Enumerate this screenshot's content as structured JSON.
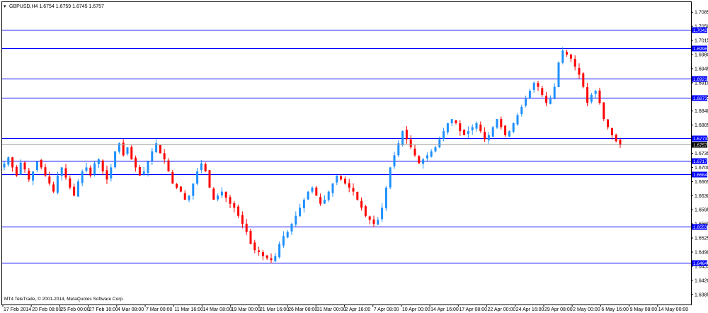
{
  "header": {
    "menu_glyph": "▾",
    "symbol_info": "GBPUSD,H4  1.6754 1.6759 1.6745 1.6757"
  },
  "footer": {
    "copyright": "MT4 TeleTrade, © 2001-2014, MetaQuotes Software Corp."
  },
  "colors": {
    "background": "#ffffff",
    "frame": "#000000",
    "bull_candle": "#1e90ff",
    "bear_candle": "#ff0000",
    "level_line": "#0000ff",
    "level_tag_bg": "#0000ff",
    "price_tag_bg": "#000000",
    "current_price_line": "#a0a0a0"
  },
  "chart_data": {
    "type": "candlestick",
    "symbol": "GBPUSD",
    "timeframe": "H4",
    "ylim": [
      1.636,
      1.711
    ],
    "y_ticks": [
      "1.7085",
      "1.7050",
      "1.7015",
      "1.6980",
      "1.6945",
      "1.6910",
      "1.6875",
      "1.6840",
      "1.6805",
      "1.6770",
      "1.6735",
      "1.6700",
      "1.6665",
      "1.6630",
      "1.6595",
      "1.6560",
      "1.6525",
      "1.6490",
      "1.6455",
      "1.6420",
      "1.6385"
    ],
    "x_ticks": [
      "17 Feb 2014",
      "20 Feb 08:00",
      "25 Feb 00:00",
      "27 Feb 16:00",
      "4 Mar 08:00",
      "7 Mar 00:00",
      "11 Mar 16:00",
      "14 Mar 08:00",
      "19 Mar 00:00",
      "21 Mar 16:00",
      "26 Mar 08:00",
      "31 Mar 00:00",
      "2 Apr 16:00",
      "7 Apr 08:00",
      "10 Apr 00:00",
      "14 Apr 16:00",
      "17 Apr 08:00",
      "22 Apr 00:00",
      "24 Apr 16:00",
      "29 Apr 08:00",
      "2 May 00:00",
      "6 May 16:00",
      "9 May 08:00",
      "14 May 00:00"
    ],
    "horizontal_levels": [
      "1.7042",
      "1.6996",
      "1.6921",
      "1.6873",
      "1.6773",
      "1.6717",
      "1.6684",
      "1.6553",
      "1.6464"
    ],
    "current_price": "1.6757",
    "grid": false,
    "closes": [
      1.671,
      1.6725,
      1.67,
      1.668,
      1.6712,
      1.6695,
      1.667,
      1.669,
      1.6715,
      1.67,
      1.668,
      1.666,
      1.664,
      1.668,
      1.67,
      1.6675,
      1.665,
      1.663,
      1.6665,
      1.669,
      1.67,
      1.668,
      1.671,
      1.672,
      1.669,
      1.667,
      1.67,
      1.674,
      1.676,
      1.673,
      1.675,
      1.672,
      1.67,
      1.668,
      1.669,
      1.6715,
      1.674,
      1.676,
      1.6735,
      1.672,
      1.669,
      1.666,
      1.665,
      1.664,
      1.662,
      1.663,
      1.666,
      1.669,
      1.671,
      1.669,
      1.665,
      1.662,
      1.663,
      1.664,
      1.6625,
      1.661,
      1.66,
      1.658,
      1.656,
      1.654,
      1.651,
      1.6495,
      1.649,
      1.648,
      1.6475,
      1.647,
      1.648,
      1.651,
      1.653,
      1.654,
      1.656,
      1.658,
      1.66,
      1.662,
      1.664,
      1.665,
      1.663,
      1.661,
      1.662,
      1.664,
      1.666,
      1.668,
      1.667,
      1.666,
      1.665,
      1.664,
      1.662,
      1.66,
      1.658,
      1.657,
      1.656,
      1.657,
      1.66,
      1.665,
      1.67,
      1.673,
      1.676,
      1.679,
      1.677,
      1.675,
      1.673,
      1.671,
      1.672,
      1.673,
      1.674,
      1.675,
      1.677,
      1.679,
      1.681,
      1.682,
      1.681,
      1.679,
      1.678,
      1.679,
      1.68,
      1.681,
      1.679,
      1.677,
      1.678,
      1.68,
      1.682,
      1.68,
      1.678,
      1.679,
      1.681,
      1.683,
      1.685,
      1.687,
      1.689,
      1.691,
      1.69,
      1.688,
      1.686,
      1.687,
      1.69,
      1.696,
      1.699,
      1.698,
      1.697,
      1.695,
      1.693,
      1.69,
      1.686,
      1.688,
      1.689,
      1.686,
      1.682,
      1.68,
      1.678,
      1.6765,
      1.6757
    ]
  }
}
